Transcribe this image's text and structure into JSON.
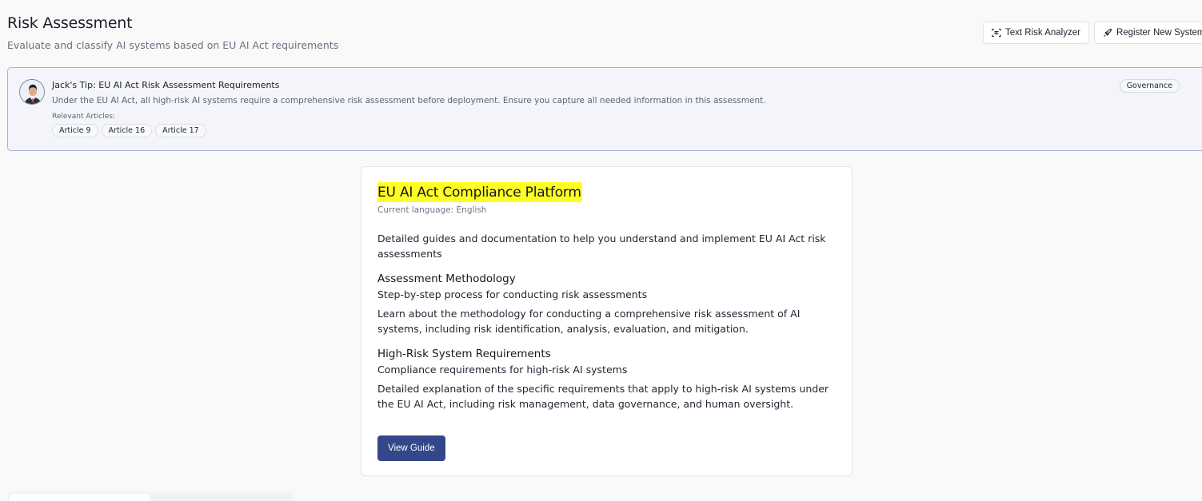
{
  "header": {
    "title": "Risk Assessment",
    "subtitle": "Evaluate and classify AI systems based on EU AI Act requirements",
    "actions": {
      "analyzer_label": "Text Risk Analyzer",
      "analyzer_icon": "scan-text-icon",
      "register_label": "Register New System",
      "register_icon": "rocket-icon"
    }
  },
  "tip": {
    "title": "Jack's Tip: EU AI Act Risk Assessment Requirements",
    "text": "Under the EU AI Act, all high-risk AI systems require a comprehensive risk assessment before deployment. Ensure you capture all needed information in this assessment.",
    "articles_label": "Relevant Articles:",
    "articles": [
      "Article 9",
      "Article 16",
      "Article 17"
    ],
    "tag": "Governance"
  },
  "guide": {
    "title": "EU AI Act Compliance Platform",
    "language": "Current language: English",
    "intro": "Detailed guides and documentation to help you understand and implement EU AI Act risk assessments",
    "sections": [
      {
        "heading": "Assessment Methodology",
        "subheading": "Step-by-step process for conducting risk assessments",
        "description": "Learn about the methodology for conducting a comprehensive risk assessment of AI systems, including risk identification, analysis, evaluation, and mitigation."
      },
      {
        "heading": "High-Risk System Requirements",
        "subheading": "Compliance requirements for high-risk AI systems",
        "description": "Detailed explanation of the specific requirements that apply to high-risk AI systems under the EU AI Act, including risk management, data governance, and human oversight."
      }
    ],
    "button_label": "View Guide"
  },
  "colors": {
    "primary": "#33478a",
    "highlight": "#fefe24",
    "tip_border": "#a9b0d1",
    "tip_background": "#f4f5fa"
  }
}
